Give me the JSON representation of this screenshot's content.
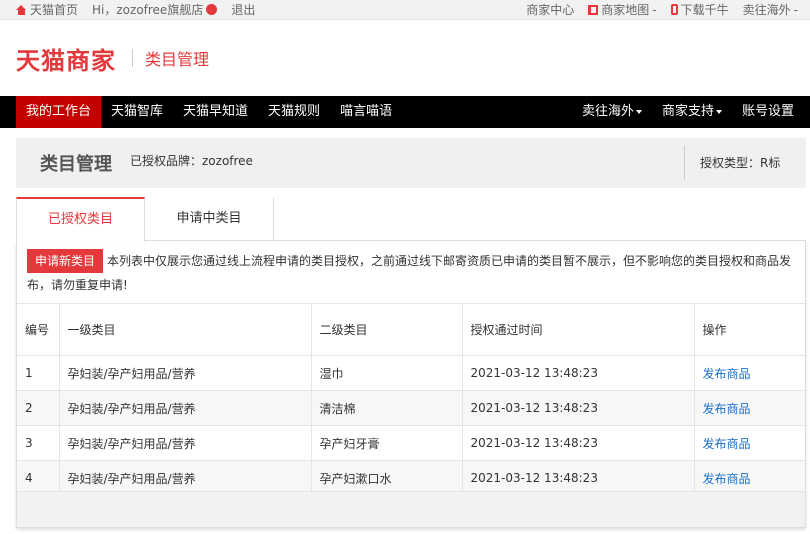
{
  "topbar": {
    "home": "天猫首页",
    "greeting": "Hi，zozofree旗舰店",
    "logout": "退出",
    "merchant_center": "商家中心",
    "sitemap": "商家地图",
    "download": "下载千牛",
    "sell_overseas": "卖往海外"
  },
  "header": {
    "logo": "天猫商家",
    "subtitle": "类目管理"
  },
  "nav": {
    "left": [
      "我的工作台",
      "天猫智库",
      "天猫早知道",
      "天猫规则",
      "喵言喵语"
    ],
    "right": [
      {
        "label": "卖往海外",
        "dropdown": true
      },
      {
        "label": "商家支持",
        "dropdown": true
      },
      {
        "label": "账号设置",
        "dropdown": false
      }
    ]
  },
  "title_panel": {
    "title": "类目管理",
    "brand": "已授权品牌：zozofree",
    "auth_type": "授权类型：R标"
  },
  "tabs": [
    "已授权类目",
    "申请中类目"
  ],
  "notice": {
    "button": "申请新类目",
    "text": "本列表中仅展示您通过线上流程申请的类目授权，之前通过线下邮寄资质已申请的类目暂不展示，但不影响您的类目授权和商品发布，请勿重复申请!"
  },
  "table": {
    "headers": [
      "编号",
      "一级类目",
      "二级类目",
      "授权通过时间",
      "操作"
    ],
    "rows": [
      {
        "num": "1",
        "l1": "孕妇装/孕产妇用品/营养",
        "l2": "湿巾",
        "time": "2021-03-12 13:48:23",
        "action": "发布商品"
      },
      {
        "num": "2",
        "l1": "孕妇装/孕产妇用品/营养",
        "l2": "清洁棉",
        "time": "2021-03-12 13:48:23",
        "action": "发布商品"
      },
      {
        "num": "3",
        "l1": "孕妇装/孕产妇用品/营养",
        "l2": "孕产妇牙膏",
        "time": "2021-03-12 13:48:23",
        "action": "发布商品"
      },
      {
        "num": "4",
        "l1": "孕妇装/孕产妇用品/营养",
        "l2": "孕产妇漱口水",
        "time": "2021-03-12 13:48:23",
        "action": "发布商品"
      }
    ]
  },
  "colors": {
    "brand_red": "#e4393c",
    "nav_active": "#c40000",
    "link_blue": "#1a6fc9"
  }
}
